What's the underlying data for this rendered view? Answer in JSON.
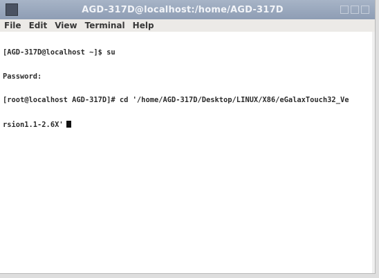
{
  "window": {
    "title": "AGD-317D@localhost:/home/AGD-317D"
  },
  "menu": {
    "items": [
      "File",
      "Edit",
      "View",
      "Terminal",
      "Help"
    ]
  },
  "terminal": {
    "lines": [
      "[AGD-317D@localhost ~]$ su",
      "Password:",
      "[root@localhost AGD-317D]# cd '/home/AGD-317D/Desktop/LINUX/X86/eGalaxTouch32_Ve",
      "rsion1.1-2.6X'"
    ]
  }
}
